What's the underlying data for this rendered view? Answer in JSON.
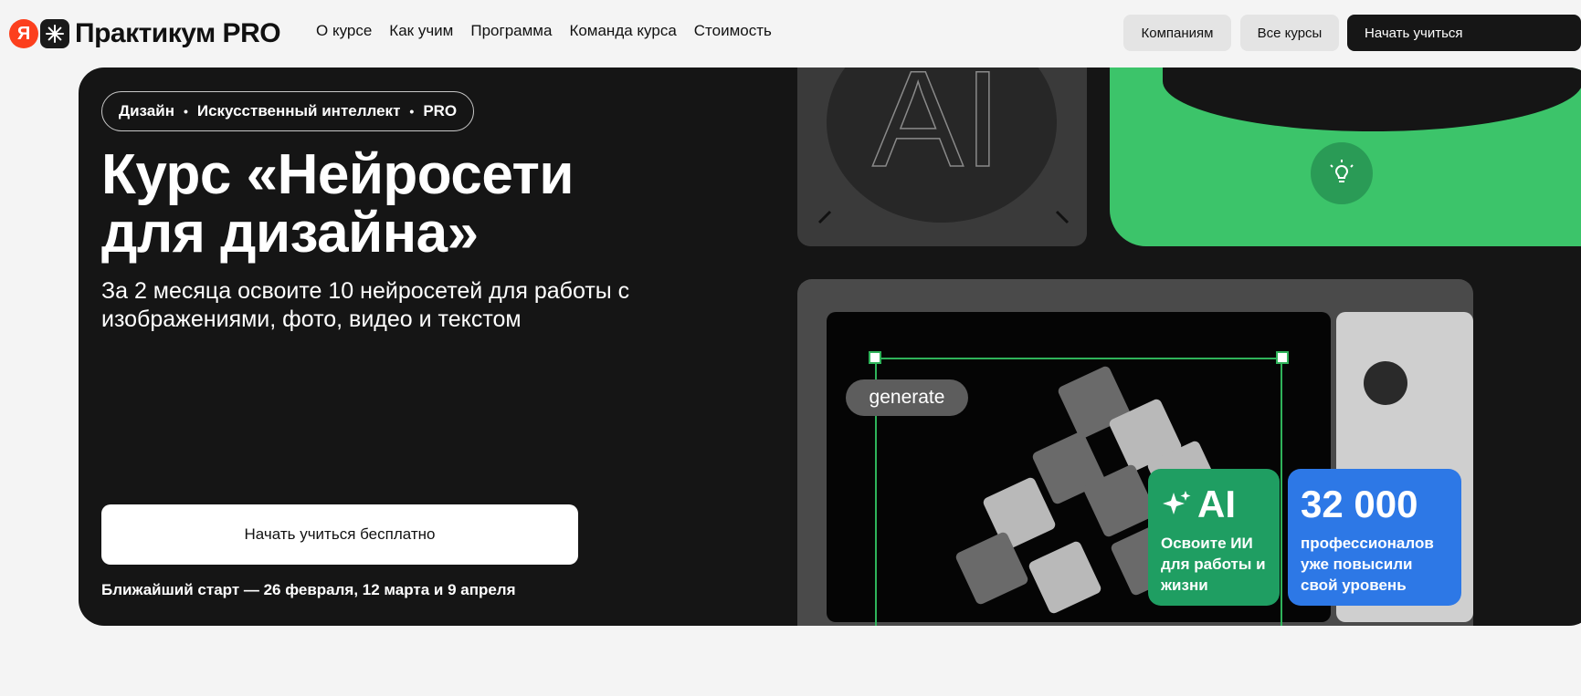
{
  "header": {
    "logo_mark": "Я",
    "logo_text": "Практикум PRO",
    "nav": [
      "О курсе",
      "Как учим",
      "Программа",
      "Команда курса",
      "Стоимость"
    ],
    "companies_label": "Компаниям",
    "all_courses_label": "Все курсы",
    "start_label": "Начать учиться"
  },
  "hero": {
    "tags": [
      "Дизайн",
      "Искусственный интеллект",
      "PRO"
    ],
    "title": "Курс «Нейросети для дизайна»",
    "subtitle": "За 2 месяца освоите 10 нейросетей для работы с изображениями, фото, видео и текстом",
    "cta_label": "Начать учиться бесплатно",
    "next_start": "Ближайший старт — 26 февраля, 12 марта и 9 апреля"
  },
  "art": {
    "ai_letters": "AI",
    "generate_label": "generate",
    "badge_ai_title": "AI",
    "badge_ai_text": "Освоите ИИ для работы и жизни",
    "badge_count_title": "32 000",
    "badge_count_text": "профессионалов уже повысили свой уровень",
    "colors": {
      "green": "#1f9e62",
      "blue": "#2d78e6",
      "accent_green": "#3cc46a"
    }
  }
}
